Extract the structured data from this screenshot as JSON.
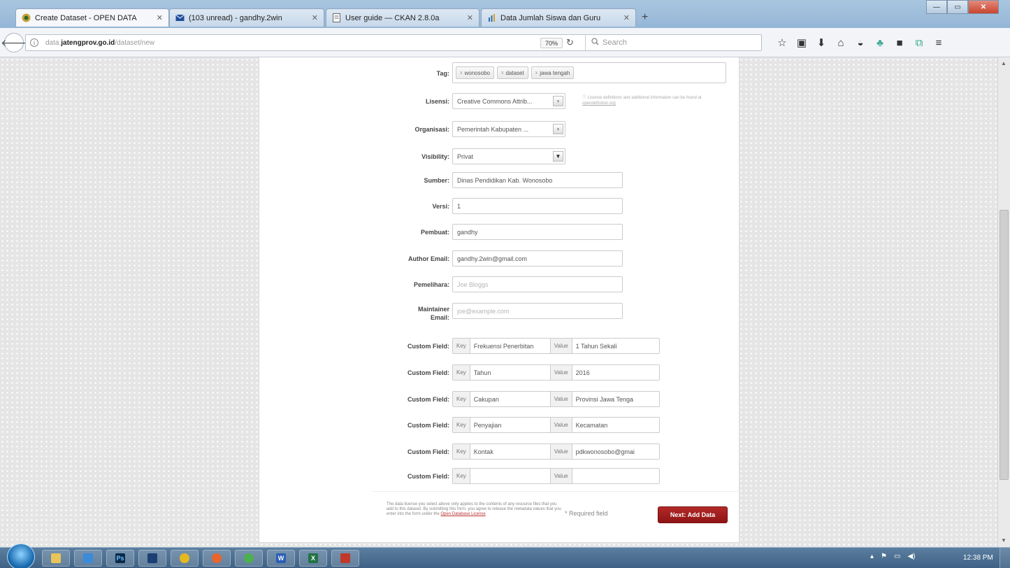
{
  "browser": {
    "tabs": [
      {
        "label": "Create Dataset - OPEN DATA",
        "icon": "jateng-logo-icon",
        "active": true
      },
      {
        "label": "(103 unread) - gandhy.2win",
        "icon": "mail-icon",
        "active": false
      },
      {
        "label": "User guide — CKAN 2.8.0a",
        "icon": "document-icon",
        "active": false
      },
      {
        "label": "Data Jumlah Siswa dan Guru",
        "icon": "data-icon",
        "active": false
      }
    ],
    "new_tab": "+",
    "url": {
      "prefix": "data.",
      "domain": "jatengprov.go.id",
      "path": "/dataset/new"
    },
    "zoom": "70%",
    "search_placeholder": "Search"
  },
  "form": {
    "tags": {
      "label": "Tag:",
      "items": [
        "wonosobo",
        "dataset",
        "jawa tengah"
      ]
    },
    "license": {
      "label": "Lisensi:",
      "value": "Creative Commons Attrib...",
      "hint": "License definitions and additional information can be found at",
      "hint_link": "opendefinition.org"
    },
    "organization": {
      "label": "Organisasi:",
      "value": "Pemerintah Kabupaten ..."
    },
    "visibility": {
      "label": "Visibility:",
      "value": "Privat"
    },
    "source": {
      "label": "Sumber:",
      "value": "Dinas Pendidikan Kab. Wonosobo"
    },
    "version": {
      "label": "Versi:",
      "value": "1"
    },
    "author": {
      "label": "Pembuat:",
      "value": "gandhy"
    },
    "author_email": {
      "label": "Author Email:",
      "value": "gandhy.2win@gmail.com"
    },
    "maintainer": {
      "label": "Pemelihara:",
      "placeholder": "Joe Bloggs"
    },
    "maintainer_email": {
      "label_line1": "Maintainer",
      "label_line2": "Email:",
      "placeholder": "joe@example.com"
    },
    "custom_field_label": "Custom Field:",
    "key_label": "Key",
    "value_label": "Value",
    "custom_fields": [
      {
        "key": "Frekuensi Penerbitan",
        "value": "1 Tahun Sekali"
      },
      {
        "key": "Tahun",
        "value": "2016"
      },
      {
        "key": "Cakupan",
        "value": "Provinsi Jawa Tenga"
      },
      {
        "key": "Penyajian",
        "value": "Kecamatan"
      },
      {
        "key": "Kontak",
        "value": "pdkwonosobo@gmai"
      },
      {
        "key": "",
        "value": ""
      }
    ]
  },
  "footer": {
    "disclaimer": "The data license you select above only applies to the contents of any resource files that you add to this dataset. By submitting this form, you agree to release the metadata values that you enter into the form under the",
    "disclaimer_link": "Open Database License",
    "required_note": "* Required field",
    "next_button": "Next: Add Data"
  },
  "taskbar": {
    "items": [
      "explorer",
      "ie",
      "ps",
      "media",
      "chrome",
      "firefox",
      "chrome2",
      "word",
      "excel",
      "app"
    ],
    "item_letters": {
      "ps": "Ps",
      "word": "W",
      "excel": "X"
    },
    "clock": "12:38 PM"
  },
  "colors": {
    "accent_button": "#9b1c1c",
    "page_bg": "#e5e5e5",
    "card_bg": "#ffffff"
  }
}
